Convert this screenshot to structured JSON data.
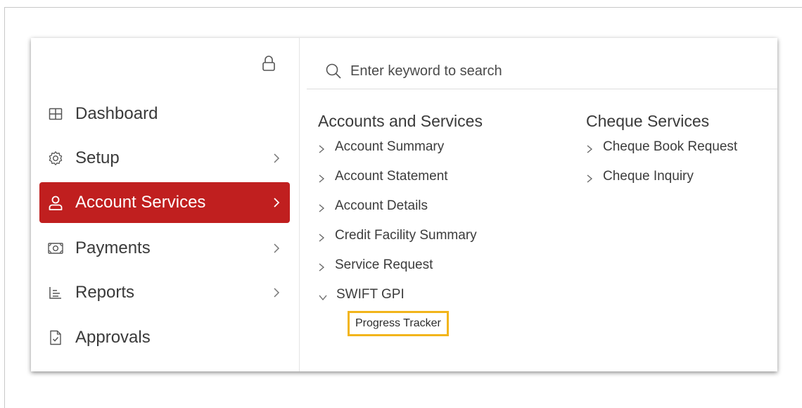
{
  "sidebar": {
    "lock_icon": "lock-icon",
    "items": [
      {
        "label": "Dashboard",
        "icon": "grid-icon",
        "has_chevron": false,
        "active": false
      },
      {
        "label": "Setup",
        "icon": "gear-icon",
        "has_chevron": true,
        "active": false
      },
      {
        "label": "Account Services",
        "icon": "user-icon",
        "has_chevron": true,
        "active": true
      },
      {
        "label": "Payments",
        "icon": "money-icon",
        "has_chevron": true,
        "active": false
      },
      {
        "label": "Reports",
        "icon": "report-icon",
        "has_chevron": true,
        "active": false
      },
      {
        "label": "Approvals",
        "icon": "approval-document-icon",
        "has_chevron": false,
        "active": false
      }
    ]
  },
  "search": {
    "placeholder": "Enter keyword to search",
    "icon": "search-icon"
  },
  "columns": [
    {
      "heading": "Accounts and Services",
      "links": [
        {
          "label": "Account Summary"
        },
        {
          "label": "Account Statement"
        },
        {
          "label": "Account Details"
        },
        {
          "label": "Credit Facility Summary"
        },
        {
          "label": "Service Request"
        },
        {
          "label": "SWIFT GPI",
          "expanded": true
        }
      ],
      "sublinks": [
        {
          "label": "Progress Tracker",
          "highlighted": true
        }
      ]
    },
    {
      "heading": "Cheque Services",
      "links": [
        {
          "label": "Cheque Book Request"
        },
        {
          "label": "Cheque Inquiry"
        }
      ]
    }
  ],
  "colors": {
    "active_background": "#c01f1f",
    "highlight_border": "#f2b51b"
  }
}
